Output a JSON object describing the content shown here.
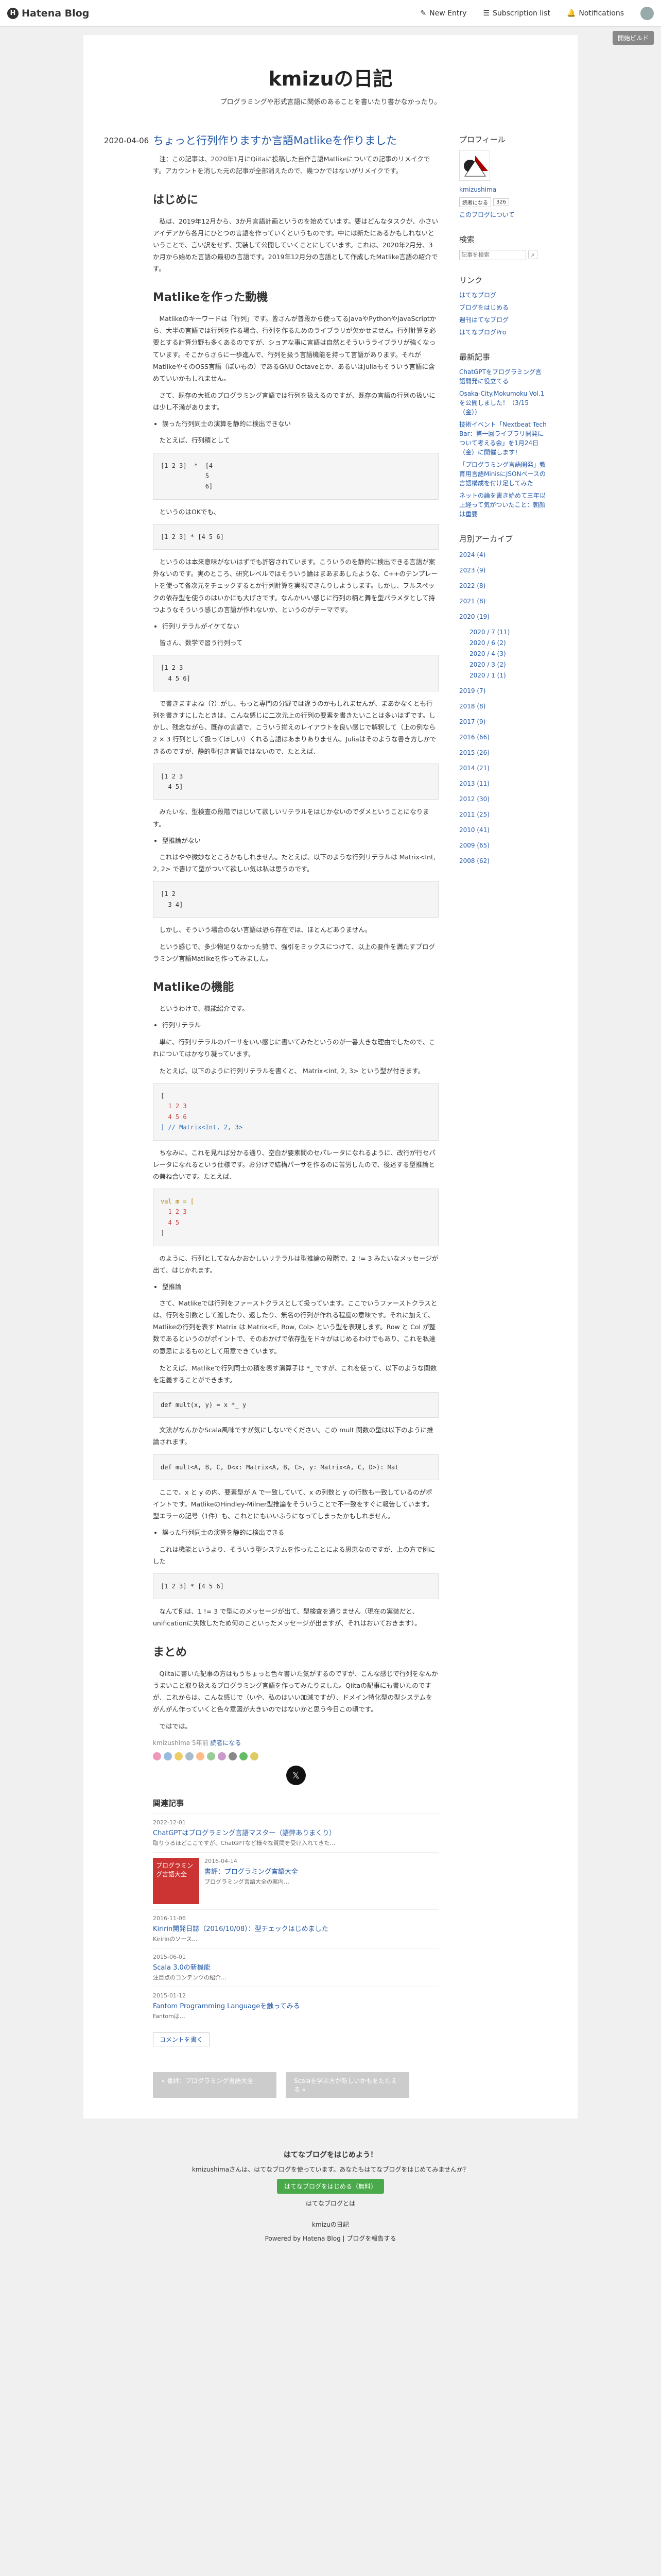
{
  "nav": {
    "logo": "Hatena Blog",
    "new_entry": "New Entry",
    "subscription": "Subscription list",
    "notifications": "Notifications",
    "pro": "開始ビルド"
  },
  "blog": {
    "title": "kmizuの日記",
    "desc": "プログラミングや形式言語に関係のあることを書いたり書かなかったり。"
  },
  "entry": {
    "date": "2020-04-06",
    "title": "ちょっと行列作りますか言語Matlikeを作りました",
    "note": "注：この記事は、2020年1月にQiitaに投稿した自作言語Matlikeについての記事のリメイクです。アカウントを消した元の記事が全部消えたので、幾つかではないがリメイクです。",
    "h_intro": "はじめに",
    "p1": "私は、2019年12月から、3か月言語計画というのを始めています。要はどんなタスクが、小さいアイデアから各月にひとつの言語を作っていくというものです。中には新たにあるかもしれないということで、言い訳をせず、実装して公開していくことにしています。これは、2020年2月分、3か月から始めた言語の最初の言語です。2019年12月分の言語として作成したMatlike言語の紹介です。",
    "h_why": "Matlikeを作った動機",
    "p2": "Matlikeのキーワードは「行列」です。皆さんが普段から使ってるJavaやPythonやJavaScriptから、大半の言語では行列を作る場合、行列を作るためのライブラリが欠かせません。行列計算を必要とする計算分野も多くあるのですが、ショアな事に言語は自然とそういうライブラリが強くなっています。そこからさらに一歩進んで、行列を扱う言語機能を持って言語があります。それがMatlikeやそのOSS言語（ぽいもの）であるGNU Octaveとか、あるいはJuliaもそういう言語に含めていいかもしれません。",
    "p3": "さて、既存の大抵のプログラミング言語では行列を扱えるのですが、既存の言語の行列の扱いには少し不満があります。",
    "li1": "誤った行列同士の演算を静的に検出できない",
    "p4": "たとえば、行列積として",
    "code1": [
      "[1 2 3]  *  [4",
      "            5",
      "            6]"
    ],
    "p5": "というのはOKでも、",
    "code2": [
      "[1 2 3] * [4 5 6]"
    ],
    "p6": "というのは本来意味がないはずでも許容されています。こういうのを静的に検出できる言語が案外ないのです。実のところ、研究レベルではそういう論はまあまあしたような、C++のテンプレートを使って各次元をチェックするとか行列計算を実現できたりしようします。しかし、フルスペックの依存型を使うのはいかにも大げさです。なんかいい感じに行列の柄と舞を型パラメタとして持つようなそういう感じの言語が作れないか、というのがテーマです。",
    "li2": "行列リテラルがイケてない",
    "p7": "皆さん、数学で習う行列って",
    "code3": [
      "[1 2 3",
      "  4 5 6]"
    ],
    "p8": "で書きますよね（?）がし、もっと専門の分野では違うのかもしれませんが、まあかなくとも行列を書きすにしたときは、こんな感じに二次元上の行列の要素を書きたいことは多いはずです。しかし、残念ながら、既存の言語で、こういう揃えのレイアウトを良い感じで解釈して（上の例なら　2 × 3 行列として扱ってほしい）くれる言語はあまりありません。Juliaはそのような書き方しかできるのですが、静的型付き言語ではないので、たとえば、",
    "code4": [
      "[1 2 3",
      "  4 5]"
    ],
    "p9": "みたいな、型検査の段階ではじいて欲しいリテラルをはじかないのでダメということになります。",
    "li3": "型推論がない",
    "p10": "これはやや微妙なところかもしれません。たとえば、以下のような行列リテラルは Matrix<Int, 2, 2> で書けて型がついて欲しい気は私は思うのです。",
    "code5": [
      "[1 2",
      "  3 4]"
    ],
    "p11": "しかし、そういう場合のない言語は恐ら存在では、ほとんどありません。",
    "p12": "という感じで、多少物足りなかった勢で、強引をミックスにつけて、以上の要件を満たすプログラミング言語Matlikeを作ってみました。",
    "h_feat": "Matlikeの機能",
    "p13": "というわけで、機能紹介です。",
    "li4": "行列リテラル",
    "p14": "単に、行列リテラルのパーサをいい感じに書いてみたというのが一番大きな理由でしたので、これについてはかなり凝っています。",
    "p15": "たとえば、以下のように行列リテラルを書くと、 Matrix<Int, 2, 3> という型が付きます。",
    "code6": [
      "[",
      "  1 2 3",
      "  4 5 6",
      "] // Matrix<Int, 2, 3>"
    ],
    "p16": "ちなみに、これを見れば分かる通り、空白が要素間のセパレータになれるように、改行が行セパレータになれるという仕様です。お分けで結構パーサを作るのに苦労したので、後述する型推論との兼ね合いです。たとえば、",
    "code7": [
      "val m = [",
      "  1 2 3",
      "  4 5",
      "]"
    ],
    "p17": "のように、行列としてなんかおかしいリテラルは型推論の段階で、2 != 3 みたいなメッセージが出て、はじかれます。",
    "li5": "型推論",
    "p18": "さて、Matlikeでは行列をファーストクラスとして扱っています。ここでいうファーストクラスとは、行列を引数として渡したり、返したり、無名の行列が作れる程度の意味です。それに加えて、Matlikeの行列を表す Matrix は Matrix<E, Row, Col> という型を表現します。Row と Col が整数であるというのがポイントで、そのおかげで依存型をドキがはじめるわけでもあり、これを私達の意思によるものとして用意できています。",
    "p19": "たとえば、Matlikeで行列同士の積を表す演算子は *_ ですが、これを使って、以下のような関数を定義することができます。",
    "code8": [
      "def mult(x, y) = x *_ y"
    ],
    "p20": "文法がなんかかScala風味ですが気にしないでください。この mult 関数の型は以下のように推論されます。",
    "code9": [
      "def mult<A, B, C, D<x: Matrix<A, B, C>, y: Matrix<A, C, D>): Mat"
    ],
    "p21": "ここで、x と y の内、要素型が A で一致していて、x の列数と y の行数も一致しているのがポイントです。MatlikeのHindley-Milner型推論をそういうことで不一致をすぐに報告しています。型エラーの記号（1件）も、これとにもいいふうになってしまったかもしれません。",
    "li6": "誤った行列同士の演算を静的に検出できる",
    "p22": "これは機能というより、そういう型システムを作ったことによる恩恵なのですが、上の方で例にした",
    "code10": [
      "[1 2 3] * [4 5 6]"
    ],
    "p23": "なんて例は、1 != 3 で型にのメッセージが出て、型検査を通りません（現在の実装だと、unificationに失敗したため何のこといったメッセージが出ますが、それはおいておきます）。",
    "h_sum": "まとめ",
    "p24": "Qiitaに書いた記事の方はもうちょっと色々書いた気がするのですが、こんな感じで行列をなんかうまいこと取り扱えるプログラミング言語を作ってみたりました。Qiitaの記事にも書いたのですが、これからは、こんな感じで（いや、私のはいい加減ですが）、ドメイン特化型の型システムをがんがん作っていくと色々意図が大きいのではないかと思う今日この頃です。",
    "p25": "ではでは。",
    "author": "kmizushima",
    "time": "5年前",
    "read": "読者になる"
  },
  "related": {
    "heading": "関連記事",
    "items": [
      {
        "date": "2022-12-01",
        "title": "ChatGPTはプログラミング言語マスター（語弊ありまくり）",
        "text": "取りうるほどここですが、ChatGPTなど様々な質問を受け入れてきた…"
      },
      {
        "date": "2016-04-14",
        "title": "書評：プログラミング言語大全",
        "text": "プログラミング言語大全の案内…",
        "thumb": "プログラミング言語大全"
      },
      {
        "date": "2016-11-06",
        "title": "Kiririn開発日誌（2016/10/08）：型チェックはじめました",
        "text": "Kiririnのソース…"
      },
      {
        "date": "2015-06-01",
        "title": "Scala 3.0の新機能",
        "text": "注目点のコンテンツの紹介…"
      },
      {
        "date": "2015-01-12",
        "title": "Fantom Programming Languageを触ってみる",
        "text": "Fantomは…"
      }
    ],
    "comment": "コメントを書く"
  },
  "pager": {
    "prev": "« 書評：プログラミング言語大全",
    "next": "Scalaを学ぶ方が新しいかもをたたえる »"
  },
  "sidebar": {
    "profile": "プロフィール",
    "name": "kmizushima",
    "follow": "読者になる",
    "count": "326",
    "about": "このブログについて",
    "search": "検索",
    "search_ph": "記事を検索",
    "links": "リンク",
    "link_items": [
      "はてなブログ",
      "ブログをはじめる",
      "週刊はてなブログ",
      "はてなブログPro"
    ],
    "recent": "最新記事",
    "recent_items": [
      "ChatGPTをプログラミング言語開発に役立てる",
      "Osaka-City.Mokumoku Vol.1を公開しました！（3/15（金））",
      "技術イベント「Nextbeat Tech Bar：第一回ライブラリ開発について考える会」を1月24日（金）に開催します！",
      "「プログラミング言語開発」教育用言語MinisにJSONベースの言語構成を付け足してみた",
      "ネットの論を書き始めて三年以上経って気がついたこと：朝顔は重要"
    ],
    "archive": "月別アーカイブ",
    "years": [
      "2024 (4)",
      "2023 (9)",
      "2022 (8)",
      "2021 (8)",
      "2020 (19)",
      "2019 (7)",
      "2018 (8)",
      "2017 (9)",
      "2016 (66)",
      "2015 (26)",
      "2014 (21)",
      "2013 (11)",
      "2012 (30)",
      "2011 (25)",
      "2010 (41)",
      "2009 (65)",
      "2008 (62)"
    ],
    "months2020": [
      "2020 / 7 (11)",
      "2020 / 6 (2)",
      "2020 / 4 (3)",
      "2020 / 3 (2)",
      "2020 / 1 (1)"
    ]
  },
  "footer": {
    "q": "はてなブログをはじめよう！",
    "p": "kmizushimaさんは、はてなブログを使っています。あなたもはてなブログをはじめてみませんか？",
    "btn": "はてなブログをはじめる（無料）",
    "about": "はてなブログとは",
    "blog": "kmizuの日記",
    "powered": "Powered by Hatena Blog | ブログを報告する"
  }
}
